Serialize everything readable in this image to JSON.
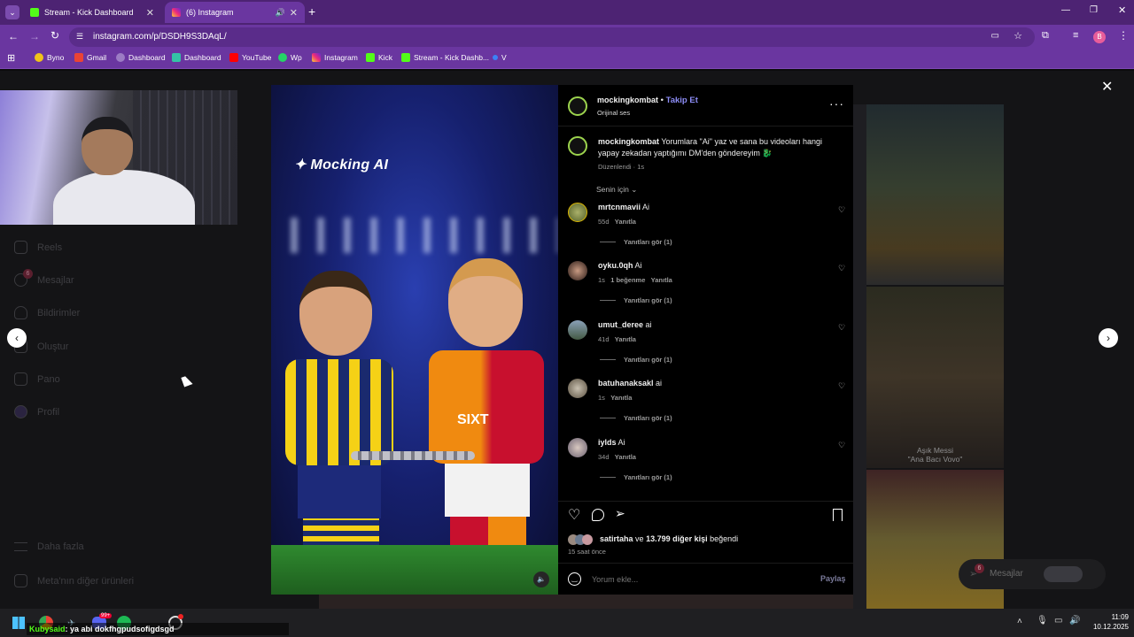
{
  "browser": {
    "tabs": [
      {
        "title": "Stream - Kick Dashboard",
        "active": false
      },
      {
        "title": "(6) Instagram",
        "active": true
      }
    ],
    "url": "instagram.com/p/DSDH9S3DAqL/",
    "bookmarks": [
      "Byno",
      "Gmail",
      "Dashboard",
      "Dashboard",
      "YouTube",
      "Wp",
      "Instagram",
      "Kick",
      "Stream - Kick Dashb...",
      "V"
    ]
  },
  "sidebar": {
    "items": [
      {
        "label": "Reels",
        "icon": "reels-icon"
      },
      {
        "label": "Mesajlar",
        "icon": "messenger-icon",
        "badge": "6"
      },
      {
        "label": "Bildirimler",
        "icon": "heart-icon"
      },
      {
        "label": "Oluştur",
        "icon": "plus-icon"
      },
      {
        "label": "Pano",
        "icon": "dashboard-icon"
      },
      {
        "label": "Profil",
        "icon": "profile-icon"
      }
    ],
    "more": "Daha fazla",
    "meta": "Meta'nın diğer ürünleri"
  },
  "post": {
    "overlay_brand": "Mocking AI",
    "sponsor_text": "SIXT",
    "author": "mockingkombat",
    "follow": "Takip Et",
    "audio": "Orijinal ses",
    "caption_author": "mockingkombat",
    "caption": "Yorumlara \"Ai\" yaz ve sana bu videoları hangi yapay zekadan yaptığımı DM'den göndereyim 🐉",
    "edited": "Düzenlendi · 1s",
    "sort": "Senin için",
    "likes_text_user": "satirtaha",
    "likes_text_rest": "ve",
    "likes_count": "13.799 diğer kişi",
    "likes_suffix": "beğendi",
    "time": "15 saat önce",
    "comment_placeholder": "Yorum ekle...",
    "share": "Paylaş"
  },
  "comments": [
    {
      "user": "mrtcnmavii",
      "text": "Ai",
      "time": "55d",
      "likes": "",
      "reply": "Yanıtla",
      "replies": "Yanıtları gör (1)"
    },
    {
      "user": "oyku.0qh",
      "text": "Ai",
      "time": "1s",
      "likes": "1 beğenme",
      "reply": "Yanıtla",
      "replies": "Yanıtları gör (1)"
    },
    {
      "user": "umut_deree",
      "text": "ai",
      "time": "41d",
      "likes": "",
      "reply": "Yanıtla",
      "replies": "Yanıtları gör (1)"
    },
    {
      "user": "batuhanaksakl",
      "text": "ai",
      "time": "1s",
      "likes": "",
      "reply": "Yanıtla",
      "replies": "Yanıtları gör (1)"
    },
    {
      "user": "iylds",
      "text": "Ai",
      "time": "34d",
      "likes": "",
      "reply": "Yanıtla",
      "replies": "Yanıtları gör (1)"
    }
  ],
  "side_posts": {
    "caption2_line1": "Aşık Messi",
    "caption2_line2": "\"Ana Bacı Vovo\""
  },
  "messages_float": {
    "label": "Mesajlar",
    "badge": "6"
  },
  "taskbar": {
    "chat_user": "Kubysaid",
    "chat_text": ": ya abi dokfhgpudsofigdsgd",
    "time": "11:09",
    "date": "10.12.2025",
    "badge": "99+"
  },
  "colors": {
    "tab_bg": "#4d2373",
    "toolbar_bg": "#6a36a0",
    "link": "#8c8cf5",
    "instagram_bg": "#000000"
  }
}
